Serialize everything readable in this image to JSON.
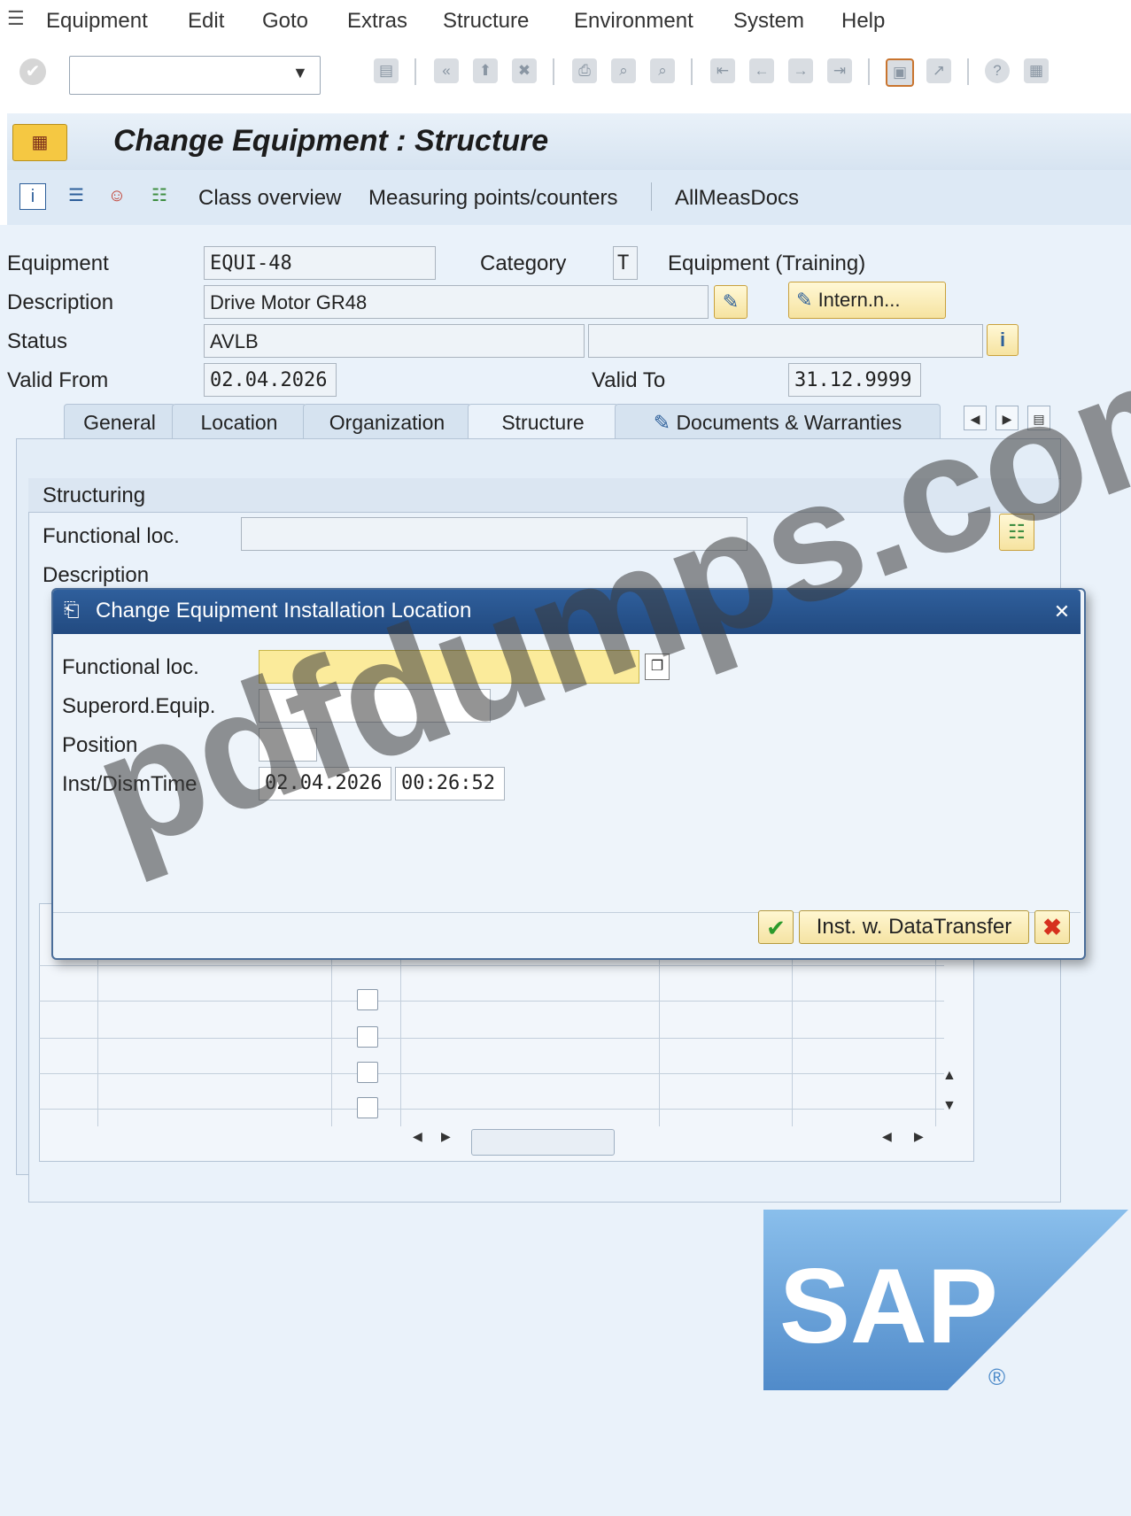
{
  "menu": {
    "items": [
      "Equipment",
      "Edit",
      "Goto",
      "Extras",
      "Structure",
      "Environment",
      "System",
      "Help"
    ]
  },
  "toolbar": {
    "command_field_value": "",
    "icons": [
      "enter-icon",
      "save-icon",
      "back-icon",
      "exit-icon",
      "cancel-icon",
      "print-icon",
      "find-icon",
      "find-next-icon",
      "first-page-icon",
      "prev-page-icon",
      "next-page-icon",
      "last-page-icon",
      "new-session-icon",
      "shortcut-icon",
      "help-icon",
      "layout-icon"
    ]
  },
  "title": {
    "text": "Change Equipment : Structure"
  },
  "app_toolbar": {
    "buttons": [
      "Class overview",
      "Measuring points/counters",
      "AllMeasDocs"
    ]
  },
  "header": {
    "equipment_label": "Equipment",
    "equipment_value": "EQUI-48",
    "category_label": "Category",
    "category_value": "T",
    "category_text": "Equipment (Training)",
    "description_label": "Description",
    "description_value": "Drive Motor GR48",
    "intern_button": "Intern.n...",
    "status_label": "Status",
    "status_value": "AVLB",
    "status_value2": "",
    "valid_from_label": "Valid From",
    "valid_from_value": "02.04.2026",
    "valid_to_label": "Valid To",
    "valid_to_value": "31.12.9999"
  },
  "tabs": [
    {
      "label": "General"
    },
    {
      "label": "Location"
    },
    {
      "label": "Organization"
    },
    {
      "label": "Structure",
      "active": true
    },
    {
      "label": "Documents & Warranties"
    }
  ],
  "structuring": {
    "group_title": "Structuring",
    "functional_loc_label": "Functional loc.",
    "functional_loc_value": "",
    "description_label": "Description"
  },
  "dialog": {
    "title": "Change Equipment Installation Location",
    "functional_loc_label": "Functional loc.",
    "functional_loc_value": "",
    "superord_label": "Superord.Equip.",
    "superord_value": "",
    "position_label": "Position",
    "position_value": "",
    "inst_time_label": "Inst/DismTime",
    "inst_date_value": "02.04.2026",
    "inst_time_value": "00:26:52",
    "inst_button": "Inst. w. DataTransfer"
  },
  "watermark": "pdfdumps.com",
  "logo_text": "SAP",
  "logo_reg": "®",
  "colors": {
    "dialog_title_bg": "#2f5f9c",
    "focus_field_bg": "#fbeb9b",
    "sap_blue": "#4b89c9"
  }
}
